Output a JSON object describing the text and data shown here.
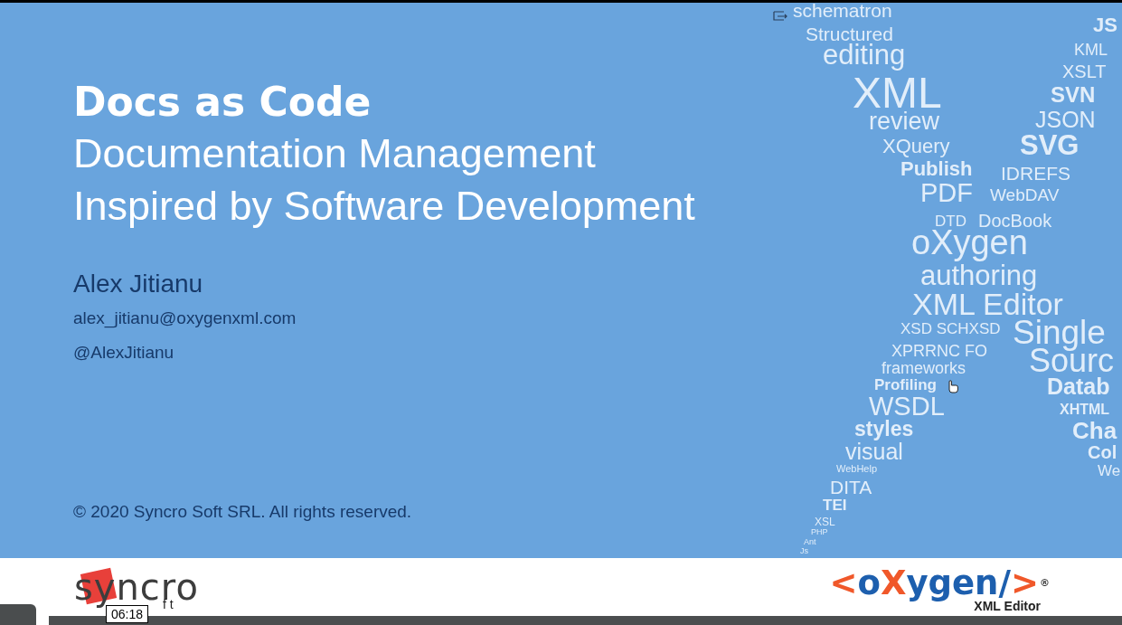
{
  "slide": {
    "title": "Docs as Code",
    "subtitle_lines": [
      "Documentation Management",
      "Inspired by Software Development"
    ],
    "author": "Alex Jitianu",
    "email": "alex_jitianu@oxygenxml.com",
    "handle": "@AlexJitianu",
    "copyright": "© 2020 Syncro Soft SRL. All rights reserved.",
    "word_cloud": [
      "schematron",
      "Structured",
      "editing",
      "XML",
      "review",
      "XQuery",
      "Publish",
      "PDF",
      "IDREFS",
      "WebDAV",
      "DTD",
      "DocBook",
      "oXygen",
      "authoring",
      "XML Editor",
      "XSD SCHXSD",
      "Single",
      "XPRRNC FO",
      "frameworks",
      "Sourc",
      "Profiling",
      "Datab",
      "WSDL",
      "XHTML",
      "styles",
      "Cha",
      "visual",
      "Col",
      "WebHelp",
      "We",
      "DITA",
      "TEI",
      "XSL",
      "PHP",
      "Ant",
      "Js",
      "JS",
      "KML",
      "XSLT",
      "SVN",
      "JSON",
      "SVG"
    ]
  },
  "footer": {
    "syncro_logo": {
      "word": "syncro",
      "subword": "f t"
    },
    "oxygen_logo": {
      "parts": [
        {
          "text": "<",
          "kind": "accent"
        },
        {
          "text": "o",
          "kind": "main"
        },
        {
          "text": "X",
          "kind": "accent"
        },
        {
          "text": "ygen",
          "kind": "main"
        },
        {
          "text": "/",
          "kind": "main"
        },
        {
          "text": ">",
          "kind": "accent"
        }
      ],
      "mark": "®",
      "caption": "XML Editor"
    }
  },
  "player": {
    "time": "06:18"
  }
}
